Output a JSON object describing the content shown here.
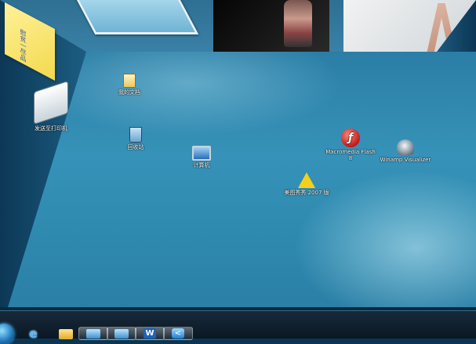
{
  "sticky_note": {
    "text": "慰贫一尽品"
  },
  "desktop_icons": [
    {
      "label": "我的文档"
    },
    {
      "label": "发送至打印机"
    },
    {
      "label": "回收站"
    },
    {
      "label": "计算机"
    },
    {
      "label": "Macromedia Flash 8"
    },
    {
      "label": "Winamp Visualizer"
    },
    {
      "label": "美图秀秀 2007 版"
    }
  ],
  "taskbar": {
    "ie_glyph": "e",
    "word_glyph": "W",
    "app5_glyph": "<"
  },
  "colors": {
    "floor": "#3692b8",
    "wall": "#0e3f5d",
    "taskbar": "#0b1824",
    "sticky": "#f3d94c"
  }
}
